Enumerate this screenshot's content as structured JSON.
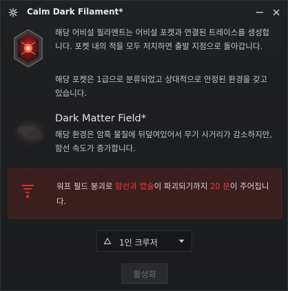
{
  "window": {
    "title": "Calm Dark Filament*"
  },
  "description": {
    "p1": "해당 어비설 필라멘트는 어비설 포켓과 연결된 트레이스를 생성합니다. 포켓 내의 적을 모두 처치하면 출발 지점으로 돌아갑니다.",
    "p2": "해당 포켓은 1급으로 분류되었고 상대적으로 안정된 환경을 갖고 있습니다."
  },
  "environment": {
    "title": "Dark Matter Field*",
    "text": "해당 환경은 암흑 물질에 뒤덮여있어서 무기 사거리가 감소하지만, 함선 속도가 증가합니다."
  },
  "warning": {
    "pre": "워프 필드 붕괴로 ",
    "highlight1": "함선과 캡슐",
    "mid": "이 파괴되기까지 ",
    "highlight2": "20 분",
    "post": "이 주어집니다."
  },
  "dropdown": {
    "selected": "1인 크루저"
  },
  "activate": {
    "label": "활성화"
  },
  "colors": {
    "highlight": "#f0383a",
    "warning_bg": "#3b1e1e",
    "background": "#1c1d1f"
  },
  "icons": {
    "app": "filament-app-icon",
    "minimize": "minimize-icon",
    "close": "close-icon",
    "filament": "calm-dark-filament-icon",
    "environment": "dark-matter-cloud-icon",
    "warning": "warp-collapse-icon",
    "ship": "ship-hull-icon",
    "dropdown": "chevron-down-icon"
  }
}
